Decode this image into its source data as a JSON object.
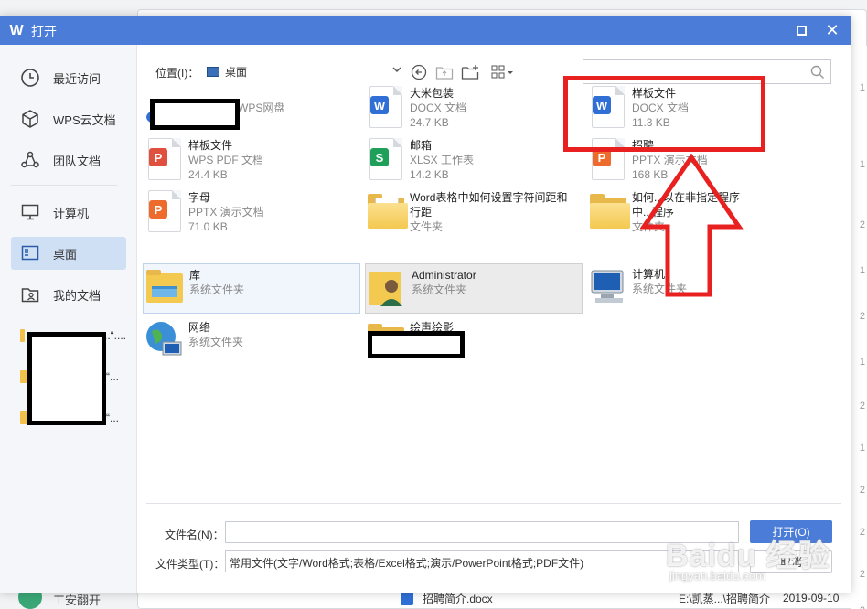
{
  "dialog": {
    "title": "打开",
    "app_logo": "W",
    "close_glyph": "✕"
  },
  "sidebar": {
    "items": [
      {
        "label": "最近访问",
        "icon": "clock-icon"
      },
      {
        "label": "WPS云文档",
        "icon": "cloud-cube-icon"
      },
      {
        "label": "团队文档",
        "icon": "team-icon"
      },
      {
        "label": "计算机",
        "icon": "monitor-icon"
      },
      {
        "label": "桌面",
        "icon": "desktop-icon",
        "active": true
      },
      {
        "label": "我的文档",
        "icon": "user-folder-icon"
      }
    ],
    "recent_entries": [
      "...“....",
      "“...",
      "“..."
    ]
  },
  "toolbar": {
    "location_label": "位置(I)：",
    "location_value": "桌面",
    "search_placeholder": ""
  },
  "files": [
    {
      "name": "",
      "sub": "WPS网盘",
      "kind": "cloud"
    },
    {
      "name": "大米包装",
      "sub": "DOCX 文档",
      "size": "24.7 KB",
      "kind": "docx"
    },
    {
      "name": "样板文件",
      "sub": "DOCX 文档",
      "size": "11.3 KB",
      "kind": "docx"
    },
    {
      "name": "样板文件",
      "sub": "WPS PDF 文档",
      "size": "24.4 KB",
      "kind": "pdf"
    },
    {
      "name": "邮箱",
      "sub": "XLSX 工作表",
      "size": "14.2 KB",
      "kind": "xlsx"
    },
    {
      "name": "招聘",
      "sub": "PPTX 演示文档",
      "size": "168 KB",
      "kind": "pptx"
    },
    {
      "name": "字母",
      "sub": "PPTX 演示文档",
      "size": "71.0 KB",
      "kind": "pptx"
    },
    {
      "name": "Word表格中如何设置字符间距和",
      "name2": "行距",
      "sub": "文件夹",
      "kind": "folder"
    },
    {
      "name": "如何...以在非指定程序",
      "name2": "中...程序",
      "sub": "文件夹",
      "kind": "folder"
    },
    {
      "name": "库",
      "sub": "系统文件夹",
      "kind": "library"
    },
    {
      "name": "Administrator",
      "sub": "系统文件夹",
      "kind": "user"
    },
    {
      "name": "计算机",
      "sub": "系统文件夹",
      "kind": "computer"
    },
    {
      "name": "网络",
      "sub": "系统文件夹",
      "kind": "network"
    },
    {
      "name": "绘声绘影",
      "sub": "",
      "kind": "folder"
    }
  ],
  "footer": {
    "filename_label": "文件名(N)：",
    "filename_value": "",
    "filetype_label": "文件类型(T)：",
    "filetype_value": "常用文件(文字/Word格式;表格/Excel格式;演示/PowerPoint格式;PDF文件)",
    "open_label": "打开(O)",
    "cancel_label": "取消"
  },
  "background": {
    "row_file": "招聘简介.docx",
    "row_path": "E:\\凯蒸...\\招聘简介",
    "row_date": "2019-09-10",
    "bottom_left_text": "工安翻开",
    "right_col": [
      "1",
      "2",
      "1",
      "2",
      "1",
      "2",
      "1",
      "2",
      "2",
      "2",
      "2",
      "1"
    ]
  },
  "watermark": {
    "brand": "Baidu 经验",
    "url": "jingyan.baidu.com"
  },
  "colors": {
    "titlebar": "#4a7cd8",
    "sidebar_active": "#cfe0f5",
    "docx": "#2f6fd6",
    "pdf": "#e0503e",
    "xlsx": "#1ea05a",
    "pptx": "#ee6b2e",
    "annotation": "#e8201f"
  }
}
